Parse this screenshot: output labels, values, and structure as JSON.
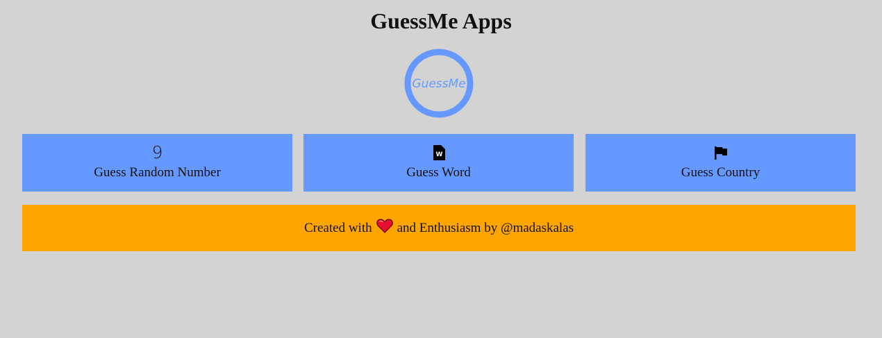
{
  "header": {
    "title": "GuessMe Apps"
  },
  "logo": {
    "text": "GuessMe",
    "color": "#6699ff"
  },
  "menu": {
    "card_color": "#6699ff",
    "items": [
      {
        "icon": "number-nine-icon",
        "icon_text": "9",
        "label": "Guess Random Number"
      },
      {
        "icon": "word-file-icon",
        "icon_text": "W",
        "label": "Guess Word"
      },
      {
        "icon": "flag-icon",
        "label": "Guess Country"
      }
    ]
  },
  "footer": {
    "background": "#ffa500",
    "text_before": "Created with",
    "icon": "heart-icon",
    "text_after": "and Enthusiasm by @madaskalas"
  }
}
